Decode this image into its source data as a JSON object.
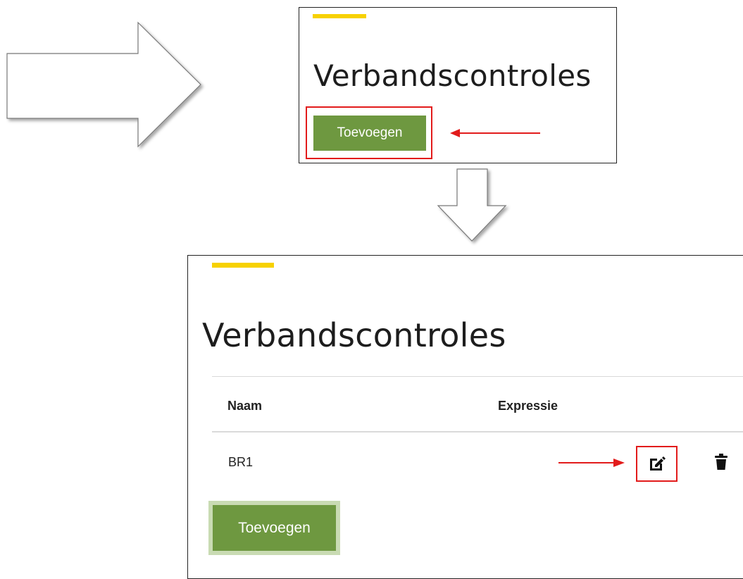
{
  "top_panel": {
    "title": "Verbandscontroles",
    "add_button_label": "Toevoegen"
  },
  "bottom_panel": {
    "title": "Verbandscontroles",
    "table": {
      "headers": [
        "Naam",
        "Expressie"
      ],
      "rows": [
        {
          "naam": "BR1",
          "expressie": ""
        }
      ]
    },
    "add_button_label": "Toevoegen"
  },
  "icons": {
    "edit": "edit-icon",
    "delete": "trash-icon",
    "annotation_arrow": "red-arrow",
    "flow_arrow": "outline-arrow"
  },
  "colors": {
    "accent_yellow": "#f7d100",
    "button_green": "#6e9840",
    "annotation_red": "#e21b1b"
  }
}
